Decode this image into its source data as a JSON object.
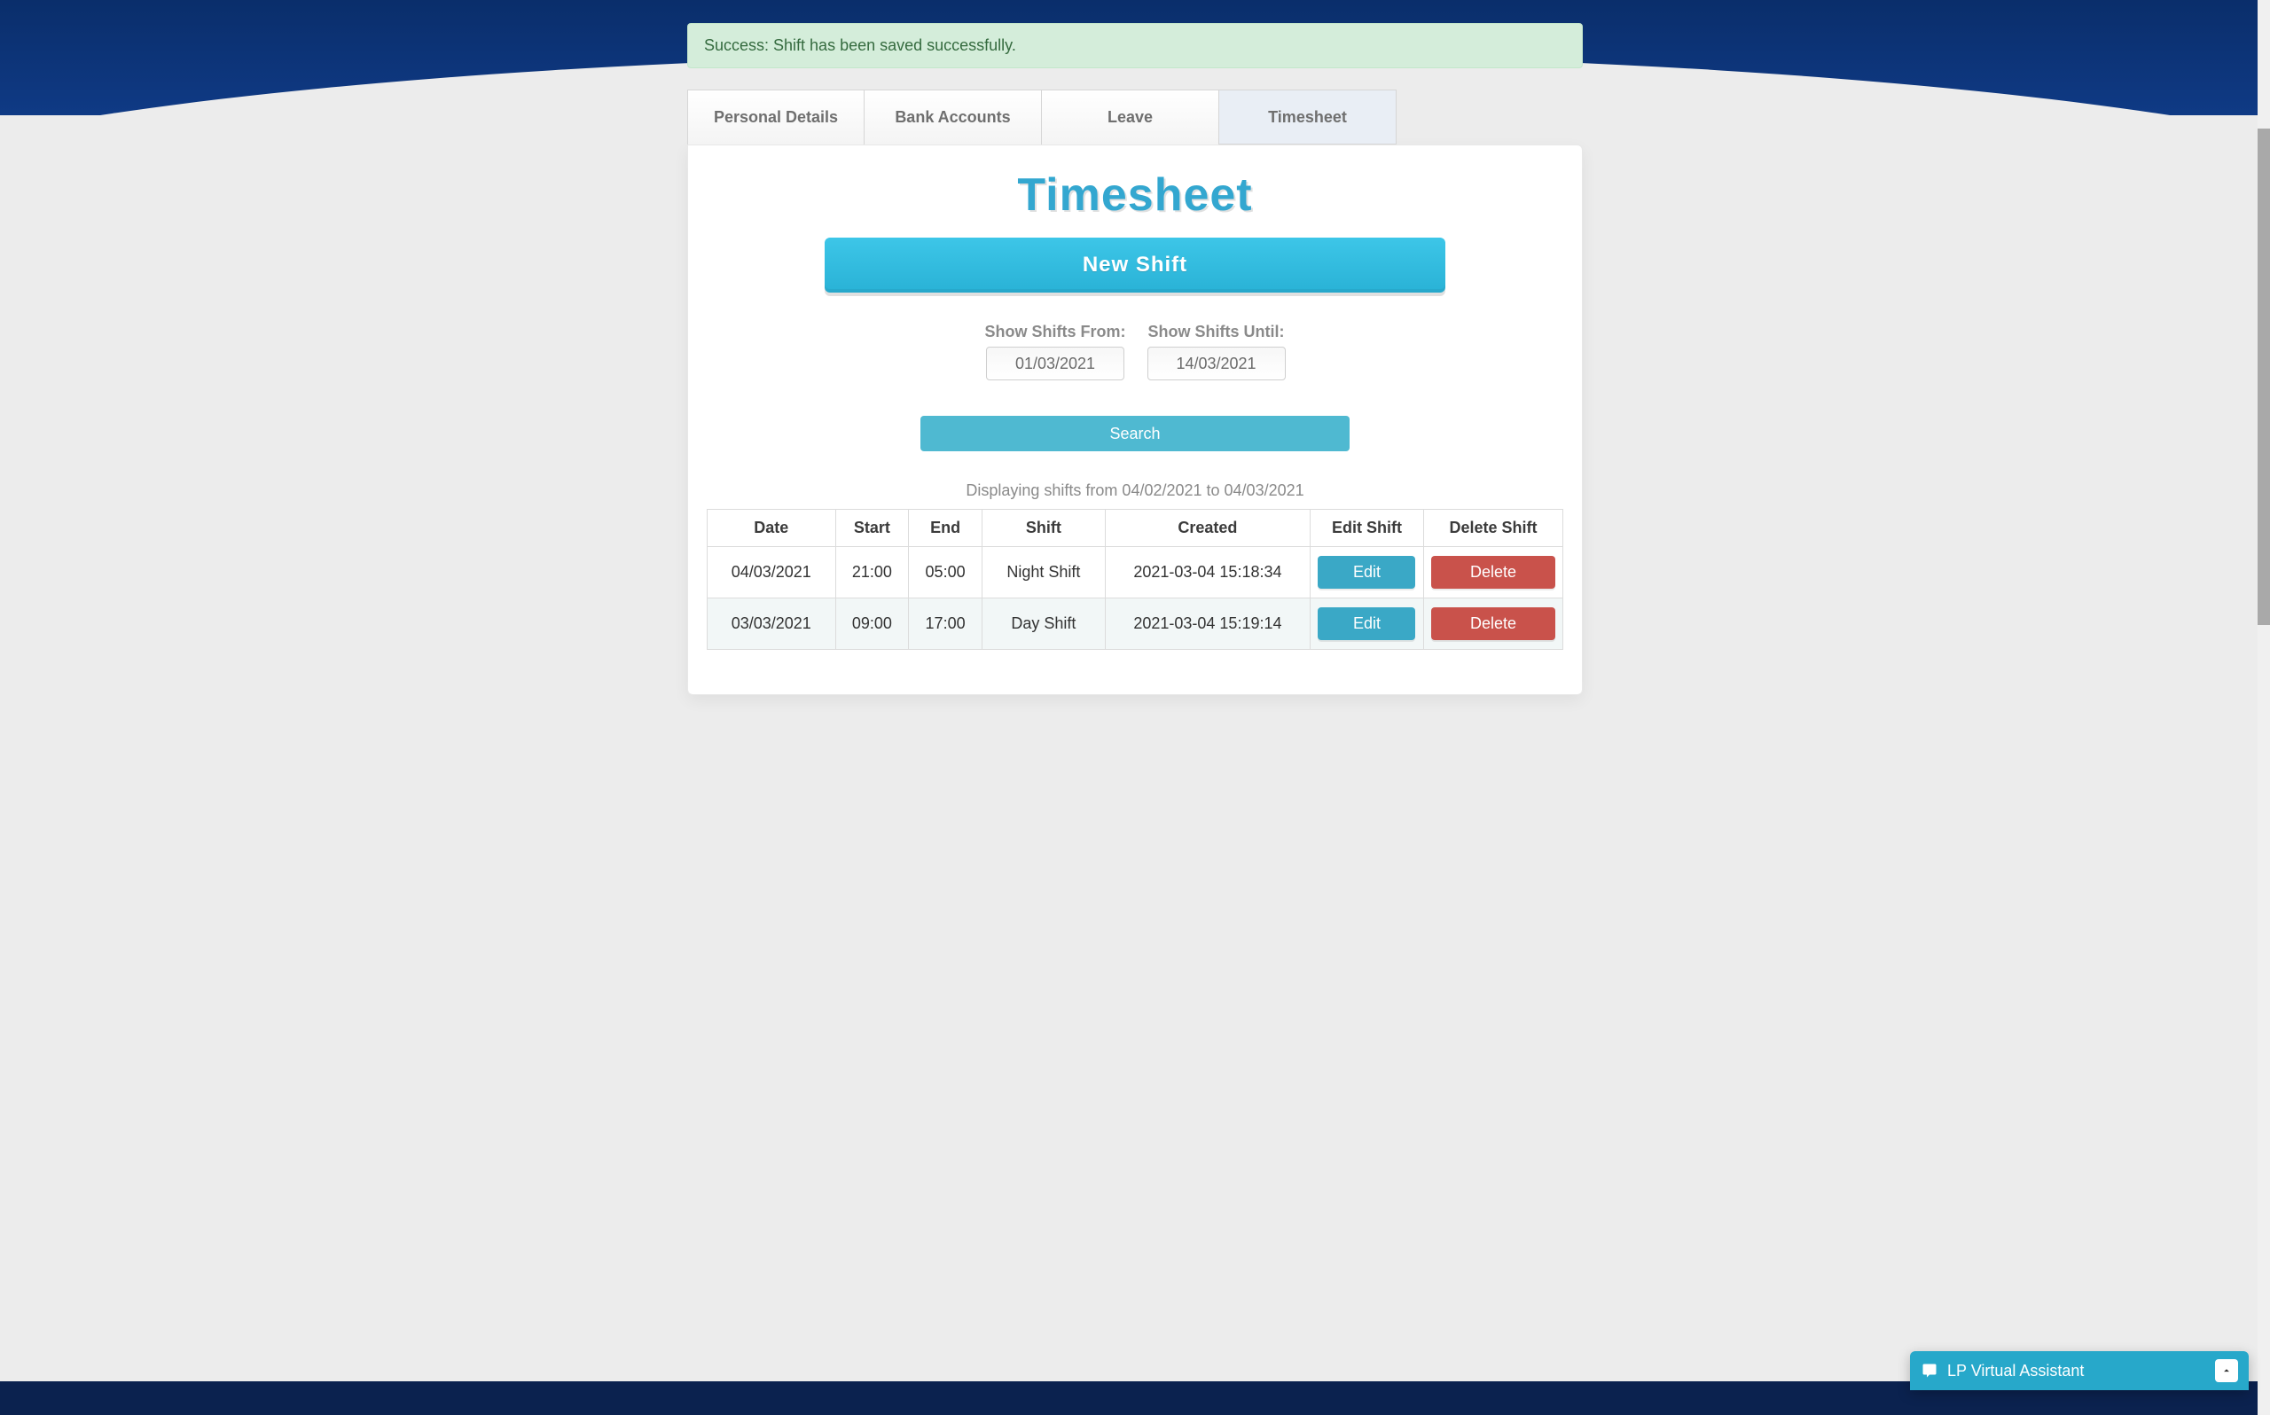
{
  "alert": {
    "message": "Success: Shift has been saved successfully."
  },
  "tabs": [
    {
      "label": "Personal Details"
    },
    {
      "label": "Bank Accounts"
    },
    {
      "label": "Leave"
    },
    {
      "label": "Timesheet"
    }
  ],
  "active_tab_index": 3,
  "page_title": "Timesheet",
  "buttons": {
    "new_shift": "New Shift",
    "search": "Search",
    "edit": "Edit",
    "delete": "Delete"
  },
  "filters": {
    "from_label": "Show Shifts From:",
    "until_label": "Show Shifts Until:",
    "from_value": "01/03/2021",
    "until_value": "14/03/2021"
  },
  "range_text": "Displaying shifts from 04/02/2021 to 04/03/2021",
  "table": {
    "headers": [
      "Date",
      "Start",
      "End",
      "Shift",
      "Created",
      "Edit Shift",
      "Delete Shift"
    ],
    "rows": [
      {
        "date": "04/03/2021",
        "start": "21:00",
        "end": "05:00",
        "shift": "Night Shift",
        "created": "2021-03-04 15:18:34"
      },
      {
        "date": "03/03/2021",
        "start": "09:00",
        "end": "17:00",
        "shift": "Day Shift",
        "created": "2021-03-04 15:19:14"
      }
    ]
  },
  "assistant": {
    "label": "LP Virtual Assistant"
  }
}
